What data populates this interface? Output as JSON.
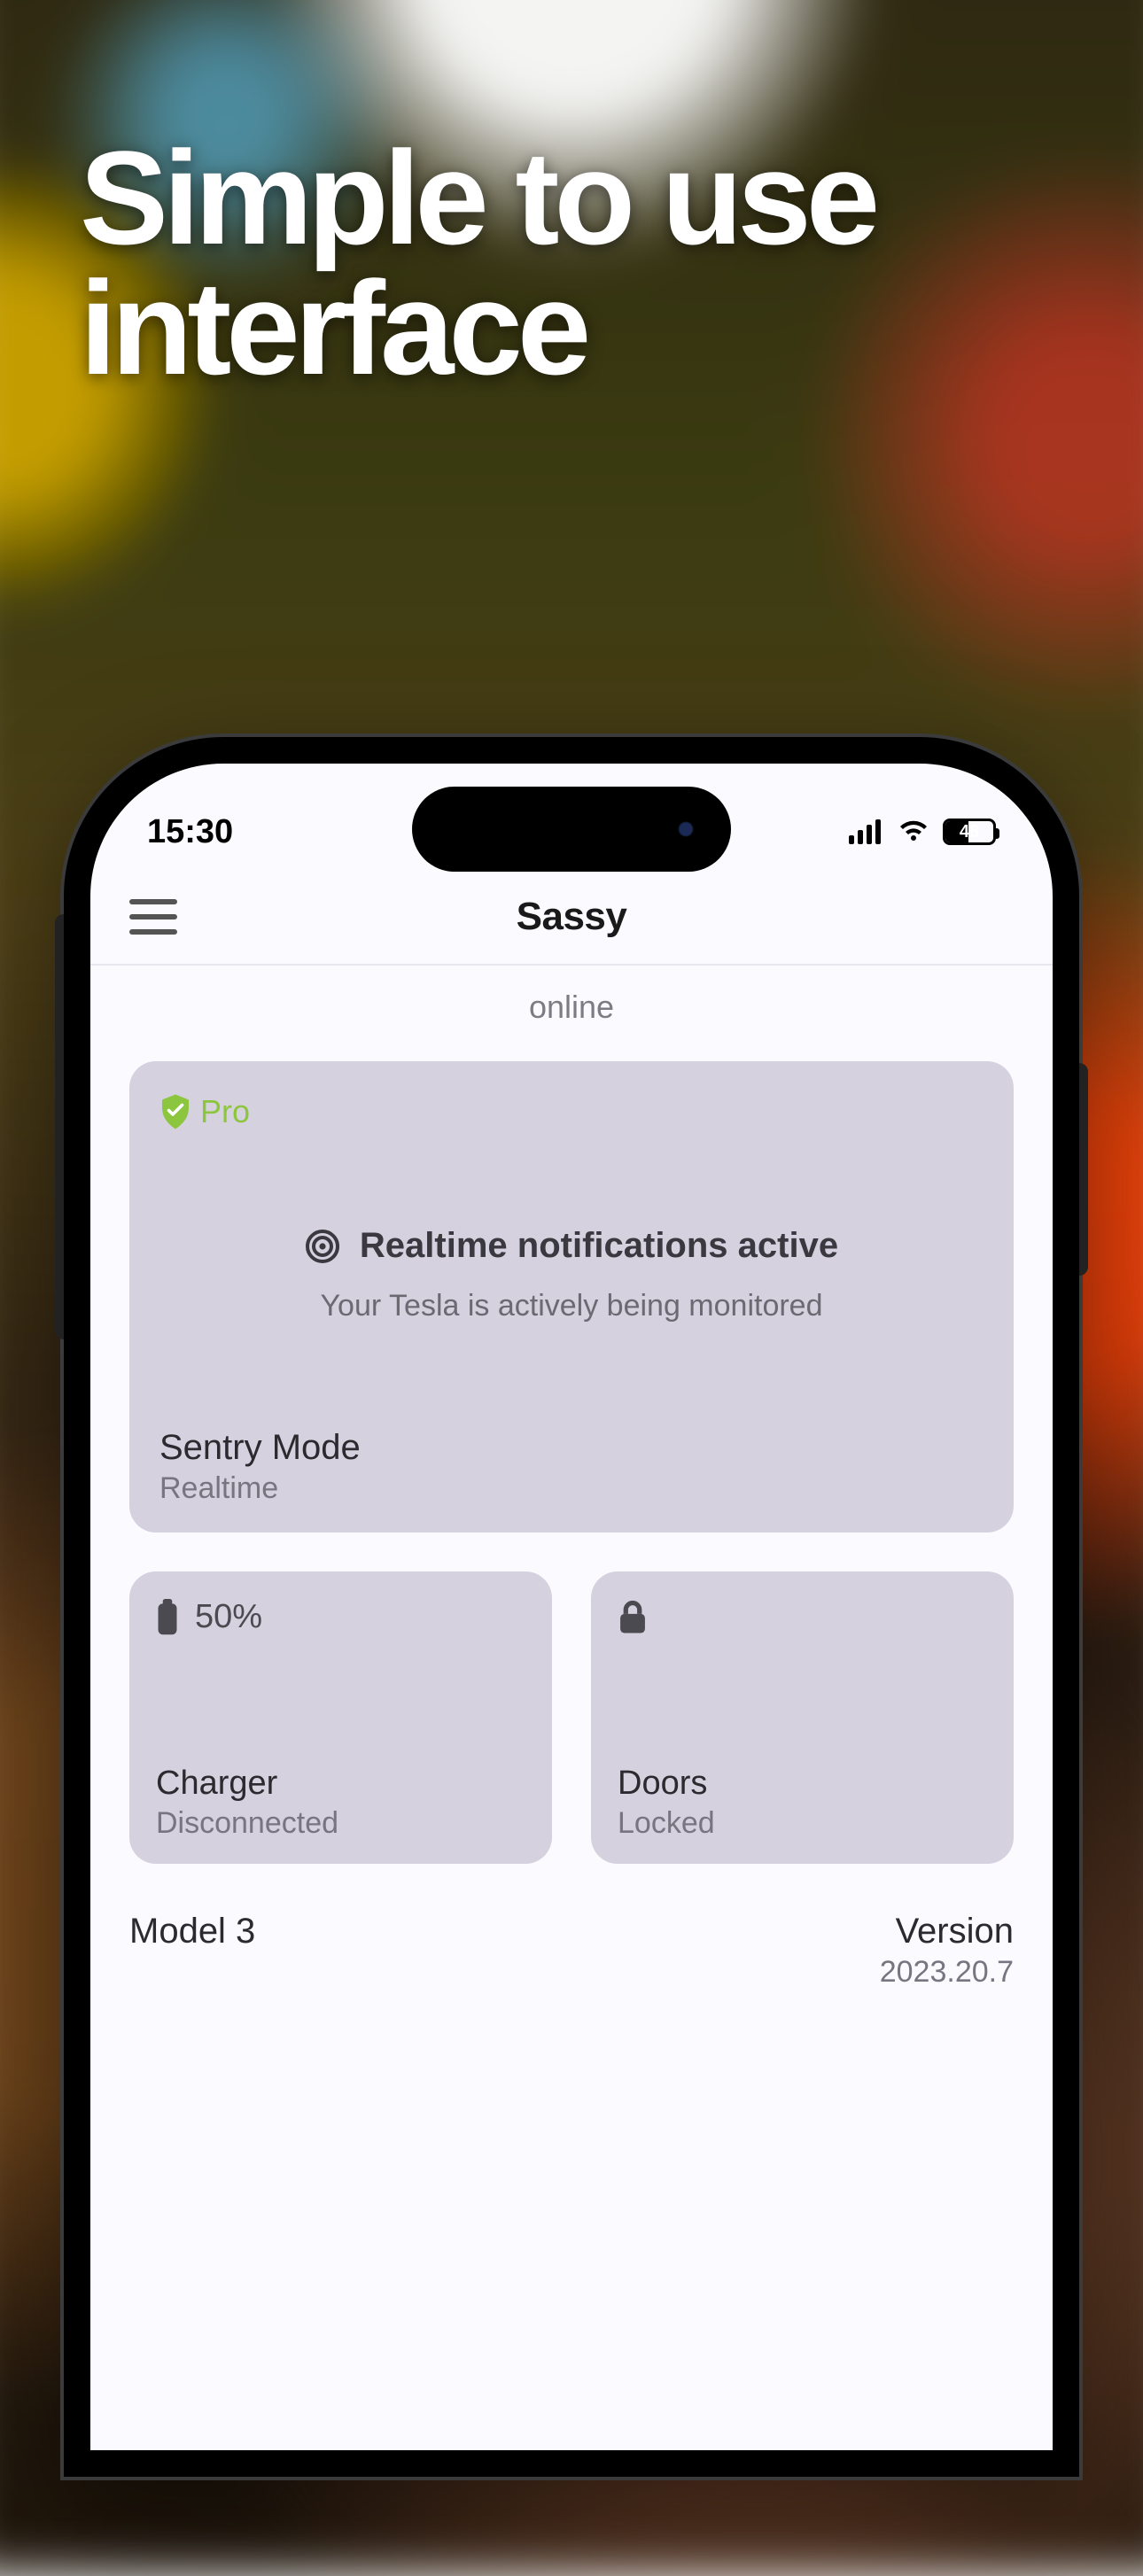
{
  "promo": {
    "headline_line1": "Simple to use",
    "headline_line2": "interface"
  },
  "statusbar": {
    "time": "15:30",
    "battery_pct": "48"
  },
  "header": {
    "title": "Sassy"
  },
  "status_line": "online",
  "sentry_card": {
    "badge": "Pro",
    "notif_title": "Realtime notifications active",
    "notif_sub": "Your Tesla is actively being monitored",
    "footer_title": "Sentry Mode",
    "footer_sub": "Realtime"
  },
  "charger_tile": {
    "level": "50%",
    "title": "Charger",
    "sub": "Disconnected"
  },
  "doors_tile": {
    "title": "Doors",
    "sub": "Locked"
  },
  "meta": {
    "model": "Model 3",
    "version_label": "Version",
    "version_value": "2023.20.7"
  }
}
